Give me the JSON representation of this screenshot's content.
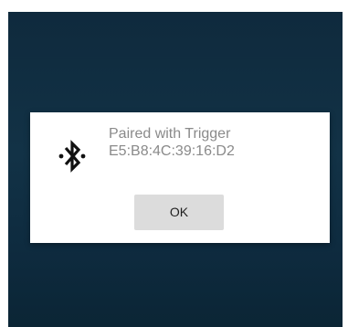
{
  "dialog": {
    "icon": "bluetooth-icon",
    "message_line1": "Paired with Trigger",
    "message_line2": "E5:B8:4C:39:16:D2",
    "ok_label": "OK"
  },
  "colors": {
    "background": "#123246",
    "dialog_bg": "#ffffff",
    "message_text": "#8a8a8a",
    "button_bg": "#dcdcdc"
  }
}
